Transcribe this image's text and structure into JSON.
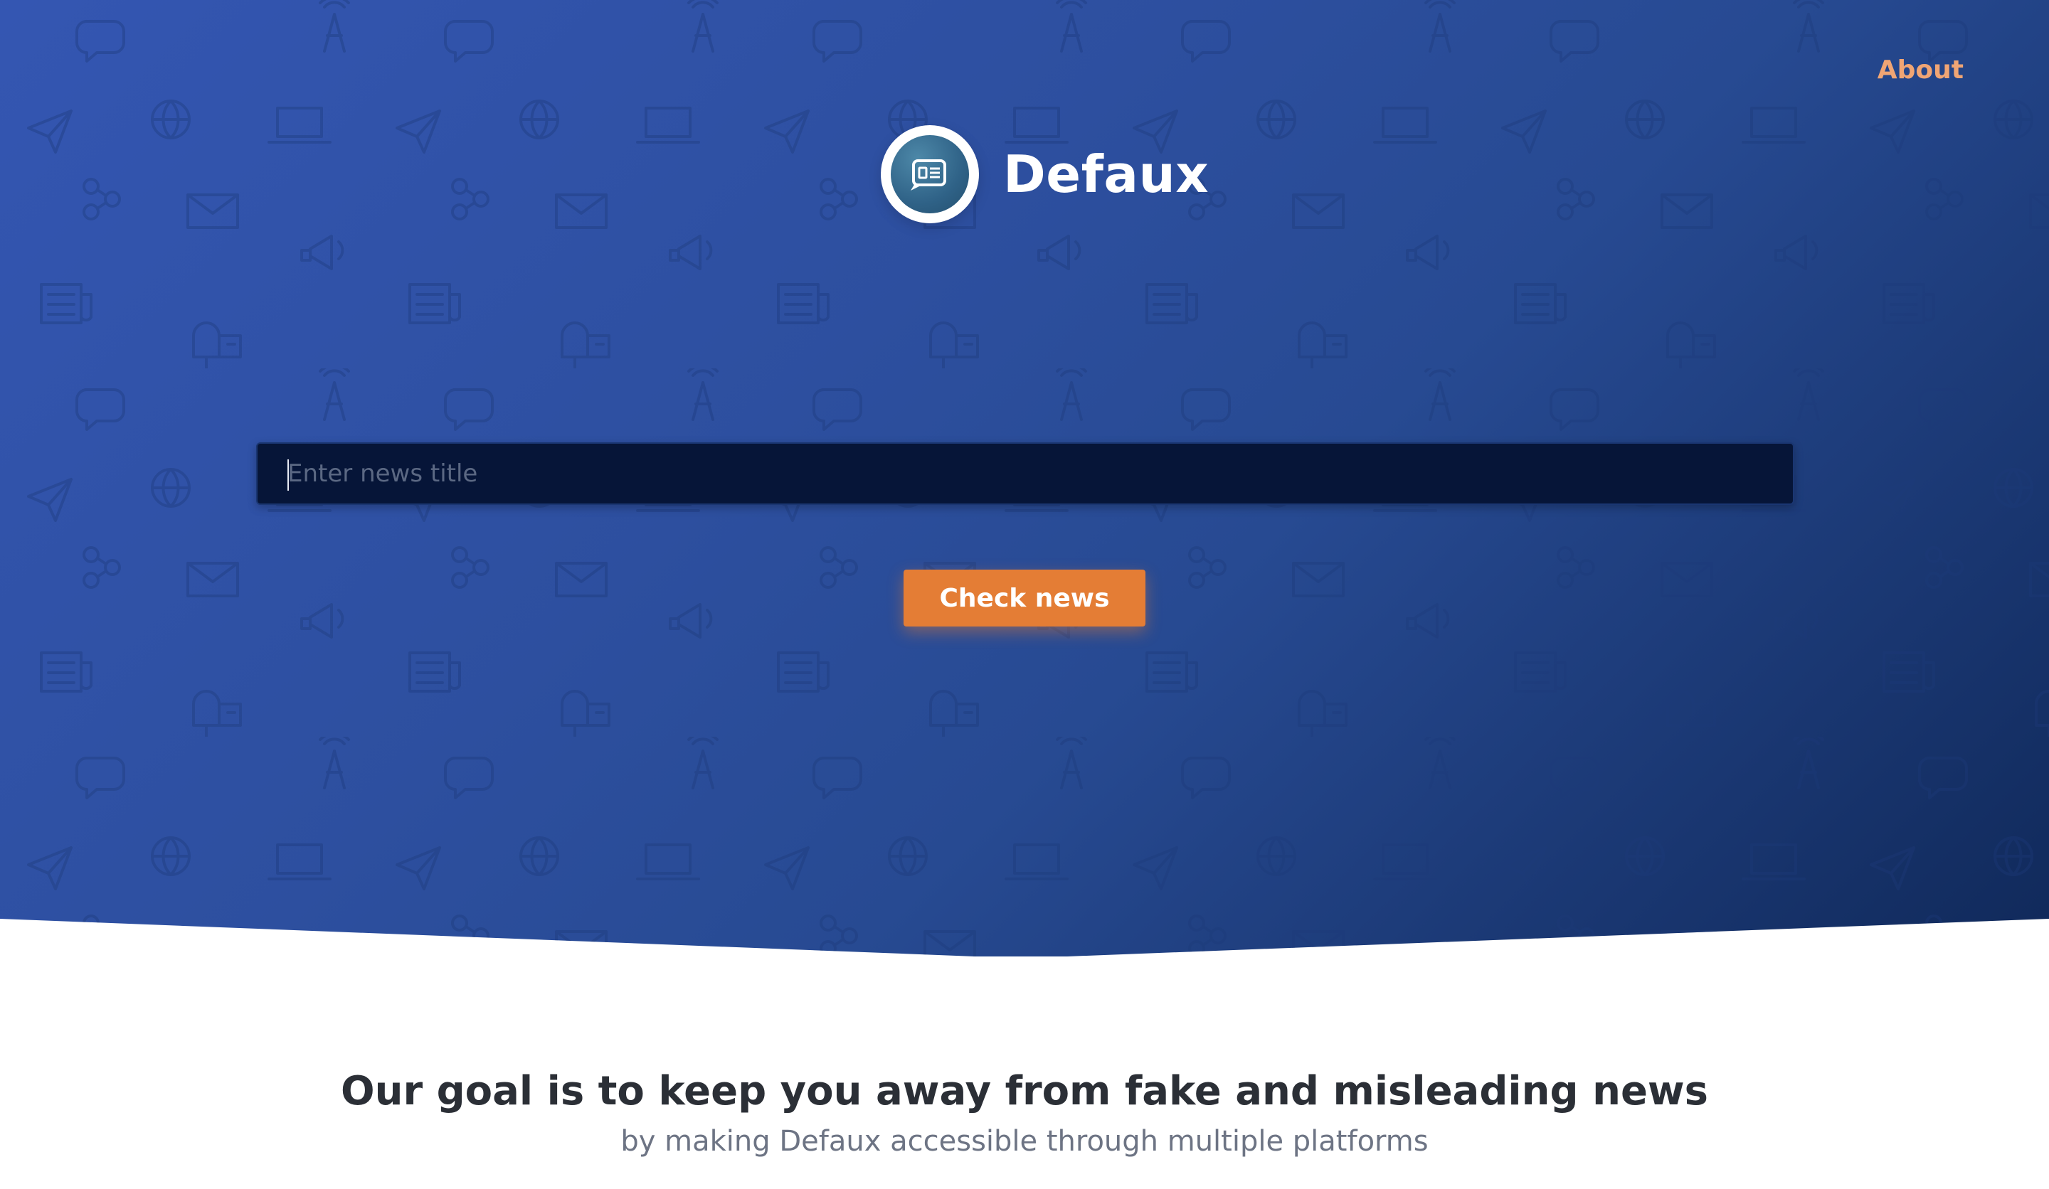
{
  "nav": {
    "about_label": "About"
  },
  "brand": {
    "name": "Defaux",
    "logo_icon": "news-chat-icon"
  },
  "search": {
    "placeholder": "Enter news title",
    "value": ""
  },
  "actions": {
    "check_label": "Check news"
  },
  "mission": {
    "title": "Our goal is to keep you away from fake and misleading news",
    "subtitle": "by making Defaux accessible through multiple platforms"
  },
  "colors": {
    "hero_gradient_start": "#3456b2",
    "hero_gradient_end": "#10295a",
    "accent": "#e47d35",
    "about_link": "#f0a574",
    "input_bg": "#061538"
  },
  "background_pattern_icons": [
    "chat-icon",
    "broadcast-tower-icon",
    "globe-icon",
    "paper-plane-icon",
    "laptop-icon",
    "share-icon",
    "envelope-icon",
    "megaphone-icon",
    "newspaper-icon",
    "mailbox-icon"
  ]
}
